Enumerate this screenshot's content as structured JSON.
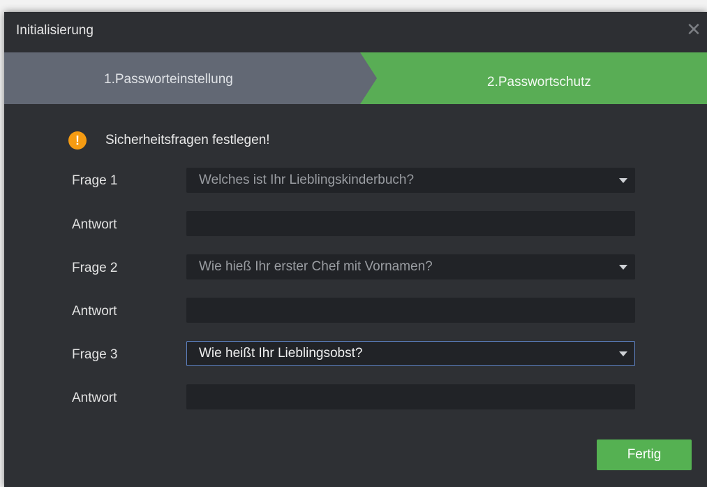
{
  "window": {
    "title": "Initialisierung",
    "close_icon": "close-icon"
  },
  "steps": {
    "step1": "1.Passworteinstellung",
    "step2": "2.Passwortschutz",
    "active_color": "#59ad55",
    "inactive_color": "#626874"
  },
  "notice": {
    "icon": "warning-icon",
    "text": "Sicherheitsfragen festlegen!",
    "icon_color": "#f59b12"
  },
  "questions": [
    {
      "label": "Frage 1",
      "selected": "Welches ist Ihr Lieblingskinderbuch?",
      "answer_label": "Antwort",
      "answer_value": ""
    },
    {
      "label": "Frage 2",
      "selected": "Wie hieß Ihr erster Chef mit Vornamen?",
      "answer_label": "Antwort",
      "answer_value": ""
    },
    {
      "label": "Frage 3",
      "selected": "Wie heißt Ihr Lieblingsobst?",
      "answer_label": "Antwort",
      "answer_value": ""
    }
  ],
  "footer": {
    "finish_label": "Fertig",
    "finish_color": "#55b152"
  }
}
